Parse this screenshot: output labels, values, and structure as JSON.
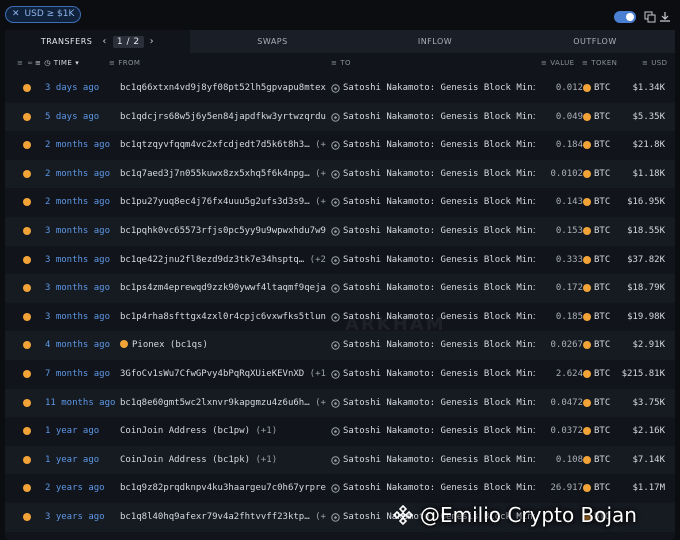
{
  "filter": {
    "label": "USD ≥ $1K"
  },
  "tabs": {
    "transfers": "TRANSFERS",
    "page_current": "1",
    "page_sep": "/",
    "page_total": "2",
    "swaps": "SWAPS",
    "inflow": "INFLOW",
    "outflow": "OUTFLOW"
  },
  "columns": {
    "time": "TIME",
    "from": "FROM",
    "to": "TO",
    "value": "VALUE",
    "token": "TOKEN",
    "usd": "USD"
  },
  "rows": [
    {
      "time": "3 days ago",
      "from": "bc1q66xtxn4vd9j8yf08pt52lh5gpvapu8mtex…",
      "more": "",
      "to": "Satoshi Nakamoto: Genesis Block Mini…",
      "value": "0.012",
      "token": "BTC",
      "usd": "$1.34K"
    },
    {
      "time": "5 days ago",
      "from": "bc1qdcjrs68w5j6y5en84japdfkw3yrtwzqrdu…",
      "more": "",
      "to": "Satoshi Nakamoto: Genesis Block Mini…",
      "value": "0.049",
      "token": "BTC",
      "usd": "$5.35K"
    },
    {
      "time": "2 months ago",
      "from": "bc1qtzqyvfqqm4vc2xfcdjedt7d5k6t8h3…",
      "more": "(+2)",
      "to": "Satoshi Nakamoto: Genesis Block Mini…",
      "value": "0.184",
      "token": "BTC",
      "usd": "$21.8K"
    },
    {
      "time": "2 months ago",
      "from": "bc1q7aed3j7n055kuwx8zx5xhq5f6k4npg…",
      "more": "(+3)",
      "to": "Satoshi Nakamoto: Genesis Block Mini…",
      "value": "0.0102",
      "token": "BTC",
      "usd": "$1.18K"
    },
    {
      "time": "2 months ago",
      "from": "bc1pu27yuq8ec4j76fx4uuu5g2ufs3d3s9…",
      "more": "(+1)",
      "to": "Satoshi Nakamoto: Genesis Block Mini…",
      "value": "0.143",
      "token": "BTC",
      "usd": "$16.95K"
    },
    {
      "time": "3 months ago",
      "from": "bc1pqhk0vc65573rfjs0pc5yy9u9wpwxhdu7w9…",
      "more": "",
      "to": "Satoshi Nakamoto: Genesis Block Mini…",
      "value": "0.153",
      "token": "BTC",
      "usd": "$18.55K"
    },
    {
      "time": "3 months ago",
      "from": "bc1qe422jnu2fl8ezd9dz3tk7e34hsptq…",
      "more": "(+23)",
      "to": "Satoshi Nakamoto: Genesis Block Mini…",
      "value": "0.333",
      "token": "BTC",
      "usd": "$37.82K"
    },
    {
      "time": "3 months ago",
      "from": "bc1ps4zm4eprewqd9zzk90ywwf4ltaqmf9qeja…",
      "more": "",
      "to": "Satoshi Nakamoto: Genesis Block Mini…",
      "value": "0.172",
      "token": "BTC",
      "usd": "$18.79K"
    },
    {
      "time": "3 months ago",
      "from": "bc1p4rha8sfttgx4zxl0r4cpjc6vxwfks5tlun…",
      "more": "",
      "to": "Satoshi Nakamoto: Genesis Block Mini…",
      "value": "0.185",
      "token": "BTC",
      "usd": "$19.98K"
    },
    {
      "time": "4 months ago",
      "from": "Pionex (bc1qs)",
      "more": "",
      "to": "Satoshi Nakamoto: Genesis Block Mini…",
      "value": "0.0267",
      "token": "BTC",
      "usd": "$2.91K"
    },
    {
      "time": "7 months ago",
      "from": "3GfoCv1sWu7CfwGPvy4bPqRqXUieKEVnXD",
      "more": "(+1)",
      "to": "Satoshi Nakamoto: Genesis Block Mini…",
      "value": "2.624",
      "token": "BTC",
      "usd": "$215.81K"
    },
    {
      "time": "11 months ago",
      "from": "bc1q8e60gmt5wc2lxnvr9kapgmzu4z6u6h…",
      "more": "(+1)",
      "to": "Satoshi Nakamoto: Genesis Block Mini…",
      "value": "0.0472",
      "token": "BTC",
      "usd": "$3.75K"
    },
    {
      "time": "1 year ago",
      "from": "CoinJoin Address (bc1pw)",
      "more": "(+1)",
      "to": "Satoshi Nakamoto: Genesis Block Mini…",
      "value": "0.0372",
      "token": "BTC",
      "usd": "$2.16K"
    },
    {
      "time": "1 year ago",
      "from": "CoinJoin Address (bc1pk)",
      "more": "(+1)",
      "to": "Satoshi Nakamoto: Genesis Block Mini…",
      "value": "0.108",
      "token": "BTC",
      "usd": "$7.14K"
    },
    {
      "time": "2 years ago",
      "from": "bc1q9z82prqdknpv4ku3haargeu7c0h67yrpre…",
      "more": "",
      "to": "Satoshi Nakamoto: Genesis Block Mini…",
      "value": "26.917",
      "token": "BTC",
      "usd": "$1.17M"
    },
    {
      "time": "3 years ago",
      "from": "bc1q8l40hq9afexr79v4a2fhtvvff23ktp…",
      "more": "(+1)",
      "to": "Satoshi Nakamoto: Genesis Block Mini…",
      "value": "",
      "token": "BTC",
      "usd": ""
    }
  ],
  "watermark": "ARKHAM",
  "credit": "@Emilio Crypto Bojan",
  "colors": {
    "accent": "#5d97e6",
    "btc": "#f2a337",
    "background": "#0b0d11"
  }
}
